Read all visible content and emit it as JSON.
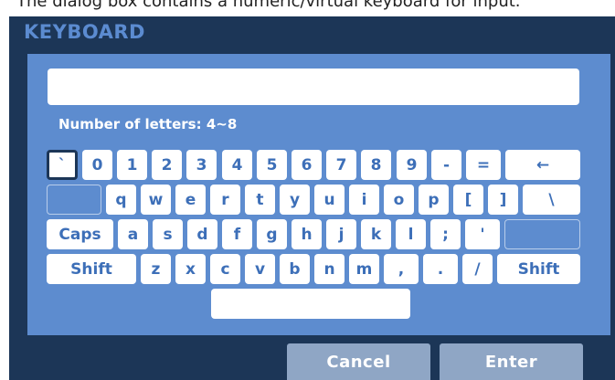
{
  "window": {
    "truncated_top_text": "The dialog box contains a numeric/virtual keyboard for input."
  },
  "dialog": {
    "title": "KEYBOARD"
  },
  "input": {
    "value": "",
    "hint": "Number of letters: 4~8"
  },
  "keyboard": {
    "row1": [
      "`",
      "0",
      "1",
      "2",
      "3",
      "4",
      "5",
      "6",
      "7",
      "8",
      "9",
      "-",
      "=",
      "←"
    ],
    "row2": [
      "",
      "q",
      "w",
      "e",
      "r",
      "t",
      "y",
      "u",
      "i",
      "o",
      "p",
      "[",
      "]",
      "\\"
    ],
    "row3": [
      "Caps",
      "a",
      "s",
      "d",
      "f",
      "g",
      "h",
      "j",
      "k",
      "l",
      ";",
      "'",
      ""
    ],
    "row4": [
      "Shift",
      "z",
      "x",
      "c",
      "v",
      "b",
      "n",
      "m",
      ",",
      ".",
      "/",
      "Shift"
    ],
    "space": ""
  },
  "buttons": {
    "cancel": "Cancel",
    "enter": "Enter"
  },
  "colors": {
    "background": "#1c3657",
    "panel": "#5d8ccf",
    "title": "#5b8bd0",
    "key_text": "#3d6fb8",
    "button": "#8fa6c5"
  }
}
